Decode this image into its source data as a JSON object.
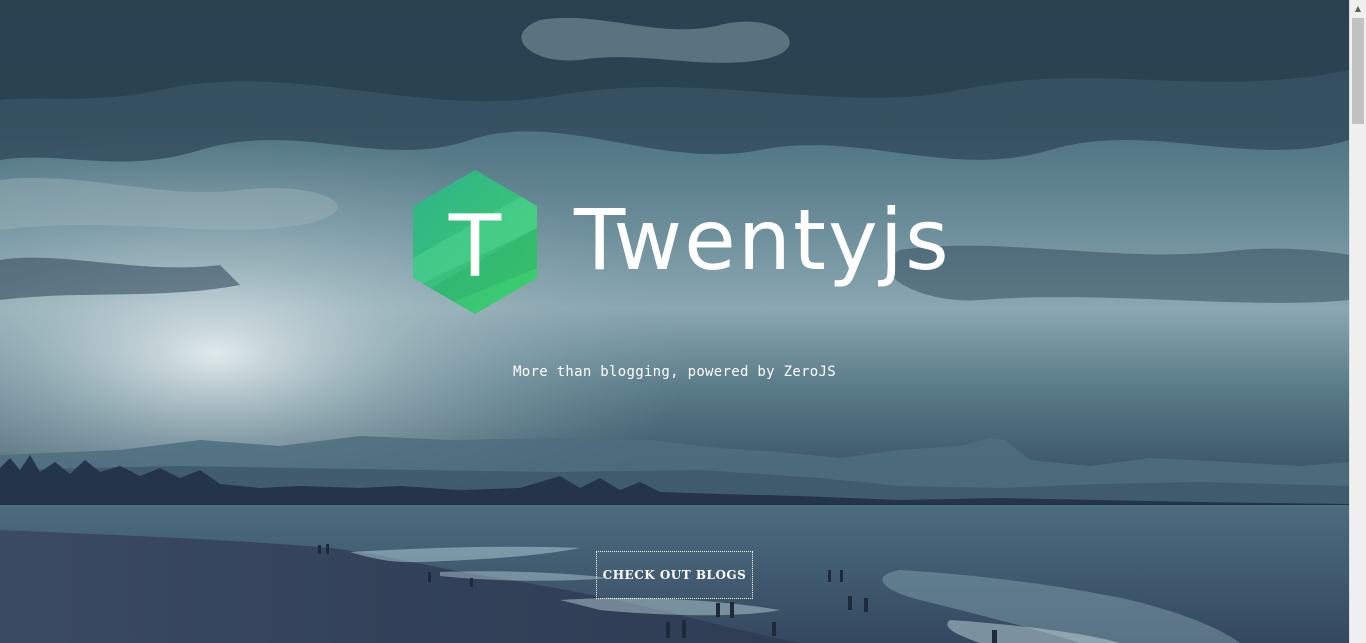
{
  "brand": {
    "logo_letter": "T",
    "name": "Twentyjs",
    "logo_colors": {
      "top": "#2fb38a",
      "bottom": "#3ecf6a"
    }
  },
  "hero": {
    "tagline": "More than blogging, powered by ZeroJS",
    "cta_label": "CHECK OUT BLOGS"
  }
}
